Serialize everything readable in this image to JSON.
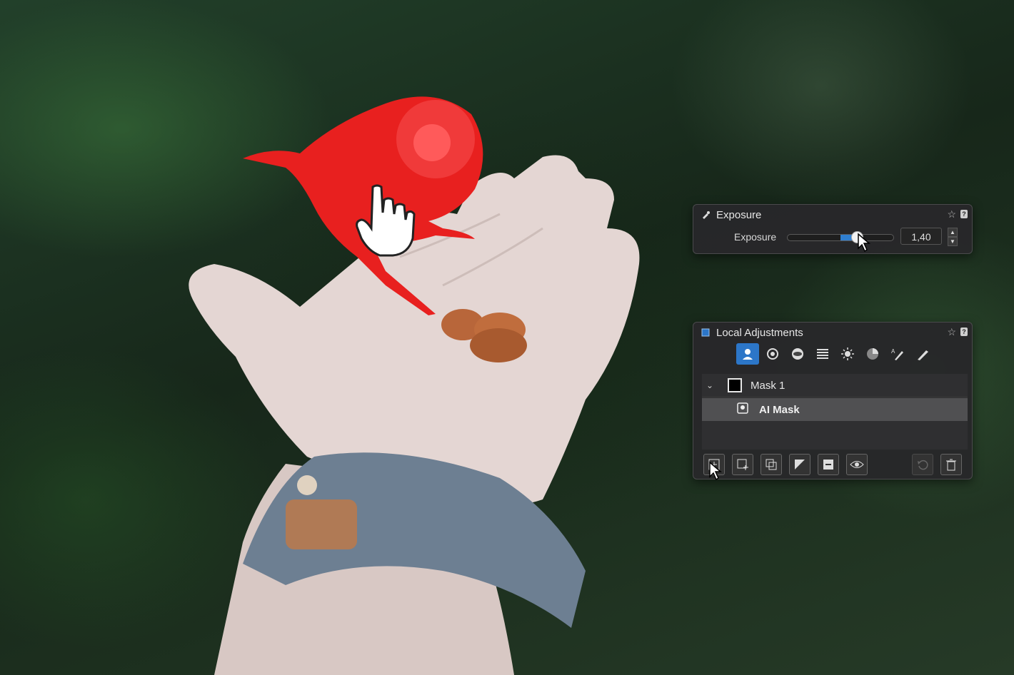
{
  "exposure_panel": {
    "title": "Exposure",
    "slider_label": "Exposure",
    "value": "1,40",
    "slider_fraction": 0.66,
    "accent_color": "#2f7fd1"
  },
  "local_panel": {
    "title": "Local Adjustments",
    "tools": [
      "ai-mask-icon",
      "radial-gradient-icon",
      "radial-icon",
      "linear-gradient-icon",
      "luminosity-icon",
      "color-range-icon",
      "auto-brush-icon",
      "brush-icon"
    ],
    "masks": [
      {
        "label": "Mask 1",
        "expanded": true
      },
      {
        "label": "AI Mask",
        "selected": true
      }
    ],
    "bottom_buttons": [
      "add-mask-icon",
      "add-layer-icon",
      "duplicate-icon",
      "invert-icon",
      "subtract-icon",
      "visibility-icon",
      "reset-icon",
      "trash-icon"
    ]
  },
  "photo": {
    "subject": "red-masked-bird-on-hand"
  }
}
